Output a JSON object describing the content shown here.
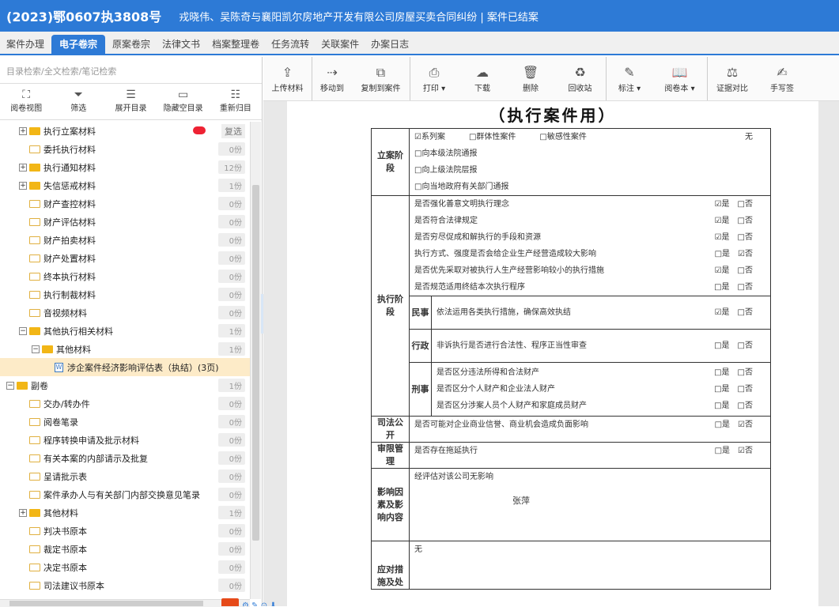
{
  "title": {
    "case_no": "(2023)鄂0607执3808号",
    "description": "戎晓伟、吴陈奇与襄阳凯尔房地产开发有限公司房屋买卖合同纠纷 | 案件已结案"
  },
  "tabs": [
    "案件办理",
    "电子卷宗",
    "原案卷宗",
    "法律文书",
    "档案整理卷",
    "任务流转",
    "关联案件",
    "办案日志"
  ],
  "left": {
    "search_placeholder": "目录检索/全文检索/笔记检索",
    "tools": [
      {
        "icon": "⛶",
        "label": "阅卷视图"
      },
      {
        "icon": "⏷",
        "label": "筛选"
      },
      {
        "icon": "☰",
        "label": "展开目录"
      },
      {
        "icon": "▭",
        "label": "隐藏空目录"
      },
      {
        "icon": "☷",
        "label": "重新归目"
      }
    ],
    "tree": [
      {
        "indent": 1,
        "exp": "+",
        "folder": "full",
        "label": "执行立案材料",
        "count": "",
        "special": "dup",
        "dup": "复选"
      },
      {
        "indent": 1,
        "exp": "",
        "folder": "empty",
        "label": "委托执行材料",
        "count": "0份"
      },
      {
        "indent": 1,
        "exp": "+",
        "folder": "full",
        "label": "执行通知材料",
        "count": "12份"
      },
      {
        "indent": 1,
        "exp": "+",
        "folder": "full",
        "label": "失信惩戒材料",
        "count": "1份"
      },
      {
        "indent": 1,
        "exp": "",
        "folder": "empty",
        "label": "财产查控材料",
        "count": "0份"
      },
      {
        "indent": 1,
        "exp": "",
        "folder": "empty",
        "label": "财产评估材料",
        "count": "0份"
      },
      {
        "indent": 1,
        "exp": "",
        "folder": "empty",
        "label": "财产拍卖材料",
        "count": "0份"
      },
      {
        "indent": 1,
        "exp": "",
        "folder": "empty",
        "label": "财产处置材料",
        "count": "0份"
      },
      {
        "indent": 1,
        "exp": "",
        "folder": "empty",
        "label": "终本执行材料",
        "count": "0份"
      },
      {
        "indent": 1,
        "exp": "",
        "folder": "empty",
        "label": "执行制裁材料",
        "count": "0份"
      },
      {
        "indent": 1,
        "exp": "",
        "folder": "empty",
        "label": "音视频材料",
        "count": "0份"
      },
      {
        "indent": 1,
        "exp": "−",
        "folder": "full",
        "label": "其他执行相关材料",
        "count": "1份"
      },
      {
        "indent": 2,
        "exp": "−",
        "folder": "full",
        "label": "其他材料",
        "count": "1份"
      },
      {
        "indent": 3,
        "exp": "",
        "folder": "file",
        "label": "涉企案件经济影响评估表（执结）(3页)",
        "count": "",
        "selected": true
      },
      {
        "indent": 0,
        "exp": "−",
        "folder": "full",
        "label": "副卷",
        "count": "1份"
      },
      {
        "indent": 1,
        "exp": "",
        "folder": "empty",
        "label": "交办/转办件",
        "count": "0份"
      },
      {
        "indent": 1,
        "exp": "",
        "folder": "empty",
        "label": "阅卷笔录",
        "count": "0份"
      },
      {
        "indent": 1,
        "exp": "",
        "folder": "empty",
        "label": "程序转换申请及批示材料",
        "count": "0份"
      },
      {
        "indent": 1,
        "exp": "",
        "folder": "empty",
        "label": "有关本案的内部请示及批复",
        "count": "0份"
      },
      {
        "indent": 1,
        "exp": "",
        "folder": "empty",
        "label": "呈请批示表",
        "count": "0份"
      },
      {
        "indent": 1,
        "exp": "",
        "folder": "empty",
        "label": "案件承办人与有关部门内部交换意见笔录",
        "count": "0份"
      },
      {
        "indent": 1,
        "exp": "+",
        "folder": "full",
        "label": "其他材料",
        "count": "1份"
      },
      {
        "indent": 1,
        "exp": "",
        "folder": "empty",
        "label": "判决书原本",
        "count": "0份"
      },
      {
        "indent": 1,
        "exp": "",
        "folder": "empty",
        "label": "裁定书原本",
        "count": "0份"
      },
      {
        "indent": 1,
        "exp": "",
        "folder": "empty",
        "label": "决定书原本",
        "count": "0份"
      },
      {
        "indent": 1,
        "exp": "",
        "folder": "empty",
        "label": "司法建议书原本",
        "count": "0份"
      }
    ],
    "hscroll_glyph": "Ш"
  },
  "toolbar": [
    {
      "icon": "⇪",
      "label": "上传材料",
      "sep": true
    },
    {
      "icon": "⇢",
      "label": "移动到"
    },
    {
      "icon": "⧉",
      "label": "复制到案件",
      "sep": true
    },
    {
      "icon": "⎙",
      "label": "打印 ▾"
    },
    {
      "icon": "☁",
      "label": "下载"
    },
    {
      "icon": "🗑",
      "label": "删除"
    },
    {
      "icon": "♻",
      "label": "回收站",
      "sep": true
    },
    {
      "icon": "✎",
      "label": "标注 ▾"
    },
    {
      "icon": "📖",
      "label": "阅卷本 ▾",
      "sep": true
    },
    {
      "icon": "⚖",
      "label": "证据对比"
    },
    {
      "icon": "✍",
      "label": "手写签"
    }
  ],
  "document": {
    "title": "（执行案件用）",
    "sections": [
      {
        "header": "立案阶段",
        "lines": [
          {
            "text": "☑系列案　　　□群体性案件　　　□敏感性案件",
            "right": "无"
          },
          {
            "text": "□向本级法院通报",
            "right": ""
          },
          {
            "text": "□向上级法院层报",
            "right": ""
          },
          {
            "text": "□向当地政府有关部门通报",
            "right": ""
          }
        ]
      },
      {
        "header": "执行阶段",
        "lines": [
          {
            "text": "是否强化善意文明执行理念",
            "right": "☑是　□否"
          },
          {
            "text": "是否符合法律规定",
            "right": "☑是　□否"
          },
          {
            "text": "是否穷尽促成和解执行的手段和资源",
            "right": "☑是　□否"
          },
          {
            "text": "执行方式、强度是否会给企业生产经营造成较大影响",
            "right": "□是　☑否"
          },
          {
            "text": "是否优先采取对被执行人生产经营影响较小的执行措施",
            "right": "☑是　□否"
          },
          {
            "text": "是否规范适用终结本次执行程序",
            "right": "□是　□否"
          }
        ],
        "subs": [
          {
            "header": "民事",
            "lines": [
              {
                "text": "依法运用各类执行措施，确保高效执结",
                "right": "☑是　□否"
              }
            ]
          },
          {
            "header": "行政",
            "lines": [
              {
                "text": "非诉执行是否进行合法性、程序正当性审查",
                "right": "□是　□否"
              }
            ]
          },
          {
            "header": "刑事",
            "lines": [
              {
                "text": "是否区分违法所得和合法财产",
                "right": "□是　□否"
              },
              {
                "text": "是否区分个人财产和企业法人财产",
                "right": "□是　□否"
              },
              {
                "text": "是否区分涉案人员个人财产和家庭成员财产",
                "right": "□是　□否"
              }
            ]
          }
        ]
      },
      {
        "header": "司法公开",
        "lines": [
          {
            "text": "是否可能对企业商业信誉、商业机会造成负面影响",
            "right": "□是　☑否"
          }
        ]
      },
      {
        "header": "审限管理",
        "lines": [
          {
            "text": "是否存在拖延执行",
            "right": "□是　☑否"
          }
        ]
      },
      {
        "header": "影响因素及影响内容",
        "lines": [
          {
            "text": "经评估对该公司无影响",
            "right": ""
          }
        ],
        "signature": "张萍"
      },
      {
        "header": "应对措施及处",
        "lines": [
          {
            "text": "无",
            "right": ""
          }
        ]
      }
    ]
  }
}
